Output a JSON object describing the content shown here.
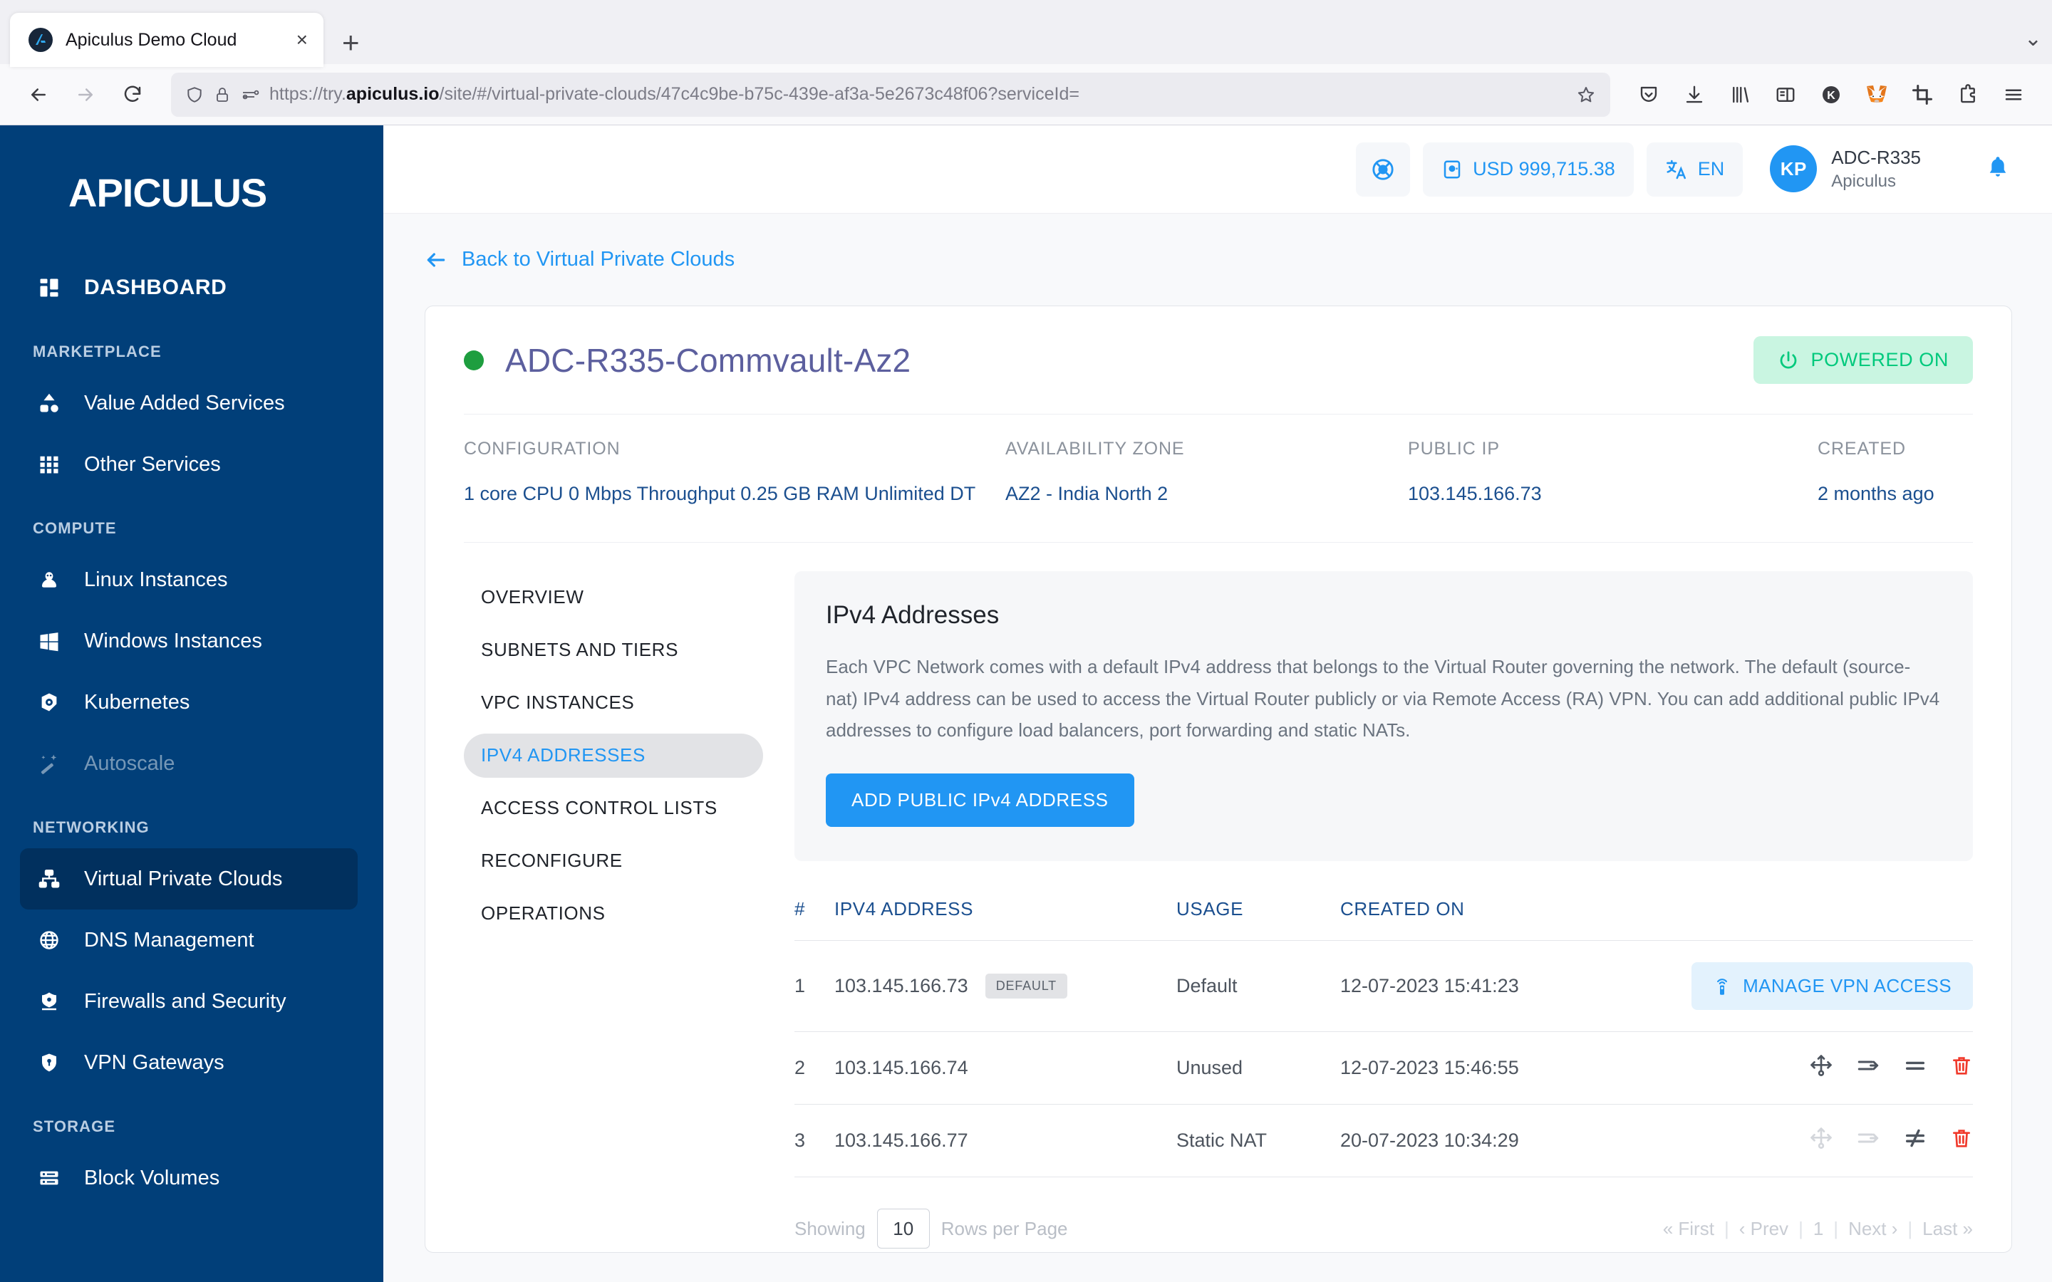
{
  "browser": {
    "tab": {
      "title": "Apiculus Demo Cloud",
      "favicon": "apiculus-logo-icon",
      "close": "×"
    },
    "new_tab": "+",
    "collapse": "⌄",
    "nav": {
      "back": "←",
      "forward": "→",
      "reload": "↻"
    },
    "url": {
      "prefix": "https://try.",
      "host": "apiculus.io",
      "suffix": "/site/#/virtual-private-clouds/47c4c9be-b75c-439e-af3a-5e2673c48f06?serviceId=",
      "full": "https://try.apiculus.io/site/#/virtual-private-clouds/47c4c9be-b75c-439e-af3a-5e2673c48f06?serviceId="
    },
    "toolbar_icons": [
      "pocket-icon",
      "download-icon",
      "library-icon",
      "sidebar-icon",
      "keeper-extension-icon",
      "metamask-extension-icon",
      "screenshot-crop-icon",
      "extensions-puzzle-icon",
      "app-menu-icon"
    ]
  },
  "sidebar": {
    "logo": "APICULUS",
    "items": [
      {
        "label": "DASHBOARD",
        "icon": "dashboard-grid-icon",
        "type": "item",
        "active": false
      },
      {
        "label": "MARKETPLACE",
        "type": "section"
      },
      {
        "label": "Value Added Services",
        "icon": "value-added-services-icon",
        "type": "item",
        "active": false
      },
      {
        "label": "Other Services",
        "icon": "apps-grid-icon",
        "type": "item",
        "active": false
      },
      {
        "label": "COMPUTE",
        "type": "section"
      },
      {
        "label": "Linux Instances",
        "icon": "linux-tux-icon",
        "type": "item",
        "active": false
      },
      {
        "label": "Windows Instances",
        "icon": "windows-icon",
        "type": "item",
        "active": false
      },
      {
        "label": "Kubernetes",
        "icon": "kubernetes-helm-icon",
        "type": "item",
        "active": false
      },
      {
        "label": "Autoscale",
        "icon": "magic-wand-icon",
        "type": "item",
        "active": false,
        "dim": true
      },
      {
        "label": "NETWORKING",
        "type": "section"
      },
      {
        "label": "Virtual Private Clouds",
        "icon": "network-topology-icon",
        "type": "item",
        "active": true
      },
      {
        "label": "DNS Management",
        "icon": "globe-icon",
        "type": "item",
        "active": false
      },
      {
        "label": "Firewalls and Security",
        "icon": "firewall-shield-icon",
        "type": "item",
        "active": false
      },
      {
        "label": "VPN Gateways",
        "icon": "vpn-shield-key-icon",
        "type": "item",
        "active": false
      },
      {
        "label": "STORAGE",
        "type": "section"
      },
      {
        "label": "Block Volumes",
        "icon": "block-volume-icon",
        "type": "item",
        "active": false
      }
    ]
  },
  "header": {
    "support_icon": "lifebuoy-support-icon",
    "wallet": {
      "icon": "wallet-icon",
      "label": "USD 999,715.38"
    },
    "language": {
      "icon": "translate-icon",
      "label": "EN"
    },
    "user": {
      "initials": "KP",
      "name": "ADC-R335",
      "org": "Apiculus"
    },
    "notifications_icon": "bell-notification-icon"
  },
  "content": {
    "back_link": {
      "arrow": "←",
      "label": "Back to Virtual Private Clouds"
    },
    "vpc": {
      "name": "ADC-R335-Commvault-Az2",
      "status_dot_color": "#1e9e3f",
      "power_badge": {
        "icon": "power-icon",
        "label": "POWERED ON",
        "bg": "#c9f5e1",
        "fg": "#00c97c"
      }
    },
    "meta": [
      {
        "label": "CONFIGURATION",
        "value": "1 core CPU 0 Mbps Throughput 0.25 GB RAM Unlimited DT"
      },
      {
        "label": "AVAILABILITY ZONE",
        "value": "AZ2 - India North 2"
      },
      {
        "label": "PUBLIC IP",
        "value": "103.145.166.73"
      },
      {
        "label": "CREATED",
        "value": "2 months ago"
      }
    ],
    "tabnav": [
      {
        "label": "OVERVIEW",
        "active": false
      },
      {
        "label": "SUBNETS AND TIERS",
        "active": false
      },
      {
        "label": "VPC INSTANCES",
        "active": false
      },
      {
        "label": "IPV4 ADDRESSES",
        "active": true
      },
      {
        "label": "ACCESS CONTROL LISTS",
        "active": false
      },
      {
        "label": "RECONFIGURE",
        "active": false
      },
      {
        "label": "OPERATIONS",
        "active": false
      }
    ],
    "panel": {
      "title": "IPv4 Addresses",
      "description": "Each VPC Network comes with a default IPv4 address that belongs to the Virtual Router governing the network. The default (source-nat) IPv4 address can be used to access the Virtual Router publicly or via Remote Access (RA) VPN. You can add additional public IPv4 addresses to configure load balancers, port forwarding and static NATs.",
      "add_button": "ADD PUBLIC IPv4 ADDRESS"
    },
    "table": {
      "columns": [
        "#",
        "IPV4 ADDRESS",
        "USAGE",
        "CREATED ON",
        ""
      ],
      "rows": [
        {
          "num": "1",
          "address": "103.145.166.73",
          "badge": "DEFAULT",
          "usage": "Default",
          "usage_state": "default",
          "created_on": "12-07-2023 15:41:23",
          "action_button": {
            "icon": "vpn-broadcast-icon",
            "label": "MANAGE VPN ACCESS"
          },
          "actions": []
        },
        {
          "num": "2",
          "address": "103.145.166.74",
          "badge": "",
          "usage": "Unused",
          "usage_state": "unused",
          "created_on": "12-07-2023 15:46:55",
          "action_button": null,
          "actions": [
            {
              "icon": "load-balancer-icon",
              "enabled": true
            },
            {
              "icon": "port-forwarding-icon",
              "enabled": true
            },
            {
              "icon": "static-nat-enable-icon",
              "enabled": true
            },
            {
              "icon": "delete-trash-icon",
              "enabled": true,
              "danger": true
            }
          ]
        },
        {
          "num": "3",
          "address": "103.145.166.77",
          "badge": "",
          "usage": "Static NAT",
          "usage_state": "static-nat",
          "created_on": "20-07-2023 10:34:29",
          "action_button": null,
          "actions": [
            {
              "icon": "load-balancer-icon",
              "enabled": false
            },
            {
              "icon": "port-forwarding-icon",
              "enabled": false
            },
            {
              "icon": "static-nat-disable-icon",
              "enabled": true
            },
            {
              "icon": "delete-trash-icon",
              "enabled": true,
              "danger": true
            }
          ]
        }
      ]
    },
    "pager": {
      "showing": "Showing",
      "rows_per_page_value": "10",
      "rows_per_page_label": "Rows per Page",
      "first": "« First",
      "prev": "‹ Prev",
      "page": "1",
      "next": "Next ›",
      "last": "Last »",
      "sep": "|"
    }
  },
  "colors": {
    "sidebar_bg": "#013f79",
    "sidebar_active": "#01305e",
    "accent_blue": "#2196f3",
    "link_navy": "#1b4f8f",
    "title_purple": "#5c5f9e",
    "success_green": "#22c06a",
    "danger_red": "#f0392b"
  }
}
